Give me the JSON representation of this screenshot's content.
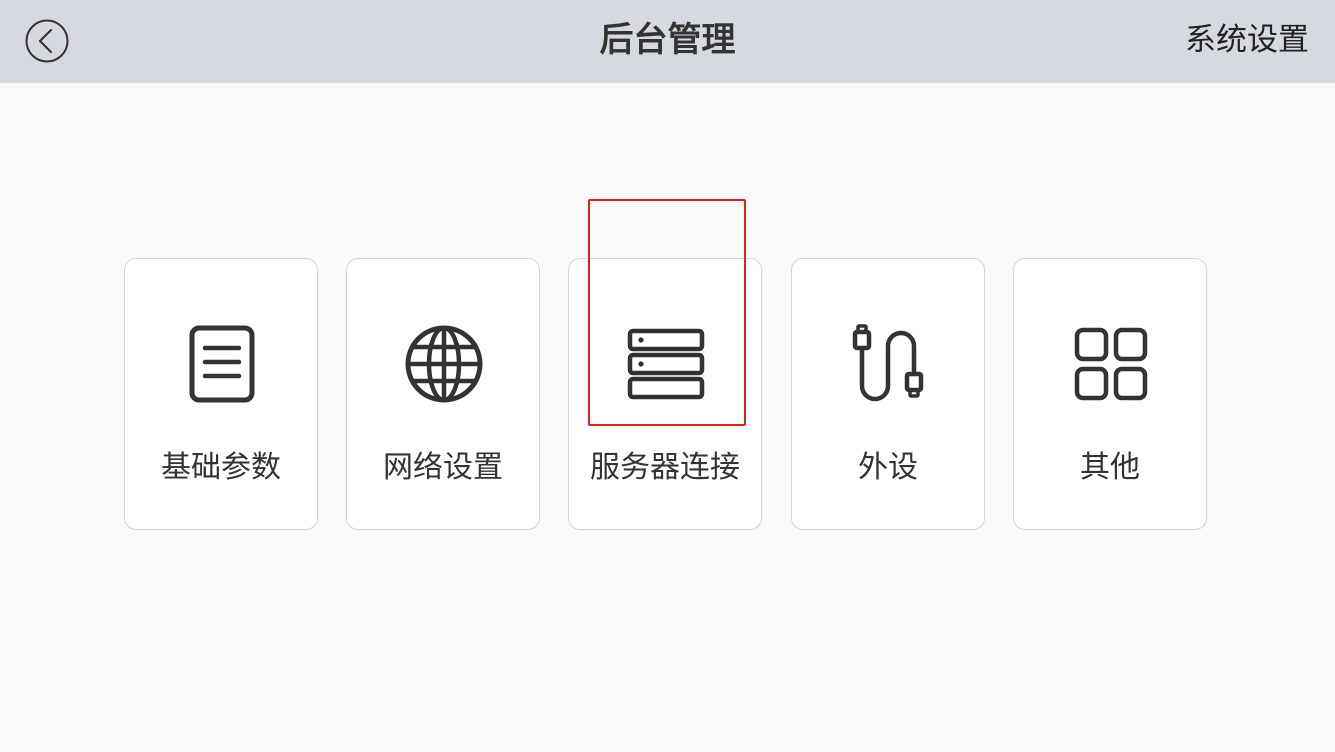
{
  "header": {
    "back_icon": "chevron-left-circle-icon",
    "title": "后台管理",
    "right_label": "系统设置"
  },
  "menu": {
    "items": [
      {
        "label": "基础参数",
        "icon": "document-list-icon"
      },
      {
        "label": "网络设置",
        "icon": "globe-icon"
      },
      {
        "label": "服务器连接",
        "icon": "server-icon",
        "focused": true
      },
      {
        "label": "外设",
        "icon": "usb-cable-icon"
      },
      {
        "label": "其他",
        "icon": "grid-apps-icon"
      }
    ]
  },
  "colors": {
    "header_bg": "#d6d9df",
    "page_bg": "#f9f9f9",
    "card_bg": "#ffffff",
    "icon": "#333333",
    "focus_outline": "#e0201a"
  }
}
